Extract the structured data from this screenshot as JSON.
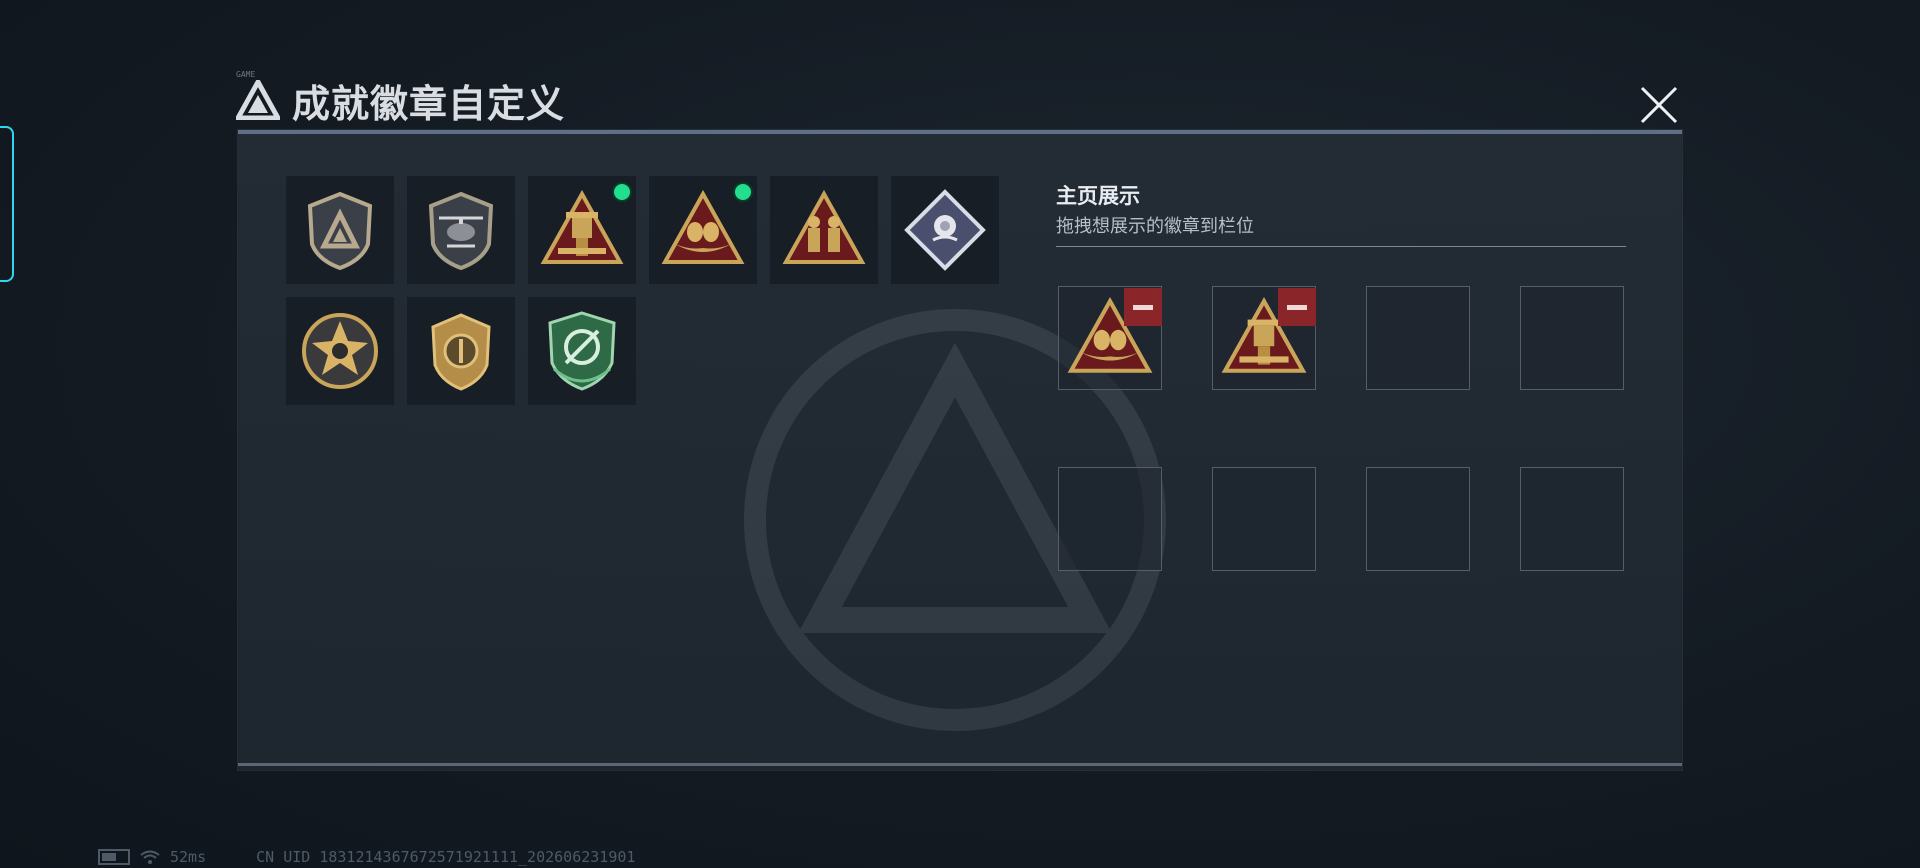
{
  "header": {
    "title": "成就徽章自定义",
    "tiny_label": "GAME"
  },
  "badges": [
    {
      "icon": "triangle-shield-badge-icon",
      "new": false
    },
    {
      "icon": "helicopter-shield-badge-icon",
      "new": false
    },
    {
      "icon": "gold-robot-triangle-badge-icon",
      "new": true
    },
    {
      "icon": "gold-eggs-triangle-badge-icon",
      "new": true
    },
    {
      "icon": "gold-soldiers-triangle-badge-icon",
      "new": false
    },
    {
      "icon": "silver-rose-diamond-badge-icon",
      "new": false
    },
    {
      "icon": "gold-star-skull-badge-icon",
      "new": false
    },
    {
      "icon": "gold-shield-emblem-badge-icon",
      "new": false
    },
    {
      "icon": "green-target-shield-badge-icon",
      "new": false
    }
  ],
  "showcase": {
    "title": "主页展示",
    "subtitle": "拖拽想展示的徽章到栏位",
    "slots": [
      {
        "icon": "gold-eggs-triangle-badge-icon",
        "filled": true
      },
      {
        "icon": "gold-robot-triangle-badge-icon",
        "filled": true
      },
      {
        "filled": false
      },
      {
        "filled": false
      },
      {
        "filled": false
      },
      {
        "filled": false
      },
      {
        "filled": false
      },
      {
        "filled": false
      }
    ]
  },
  "status": {
    "ping": "52ms",
    "uid": "CN UID 1831214367672571921111_202606231901"
  },
  "colors": {
    "accent": "#2fd6ef",
    "new_dot": "#22df8f",
    "remove": "#8a2629",
    "gold": "#c9a55a"
  }
}
